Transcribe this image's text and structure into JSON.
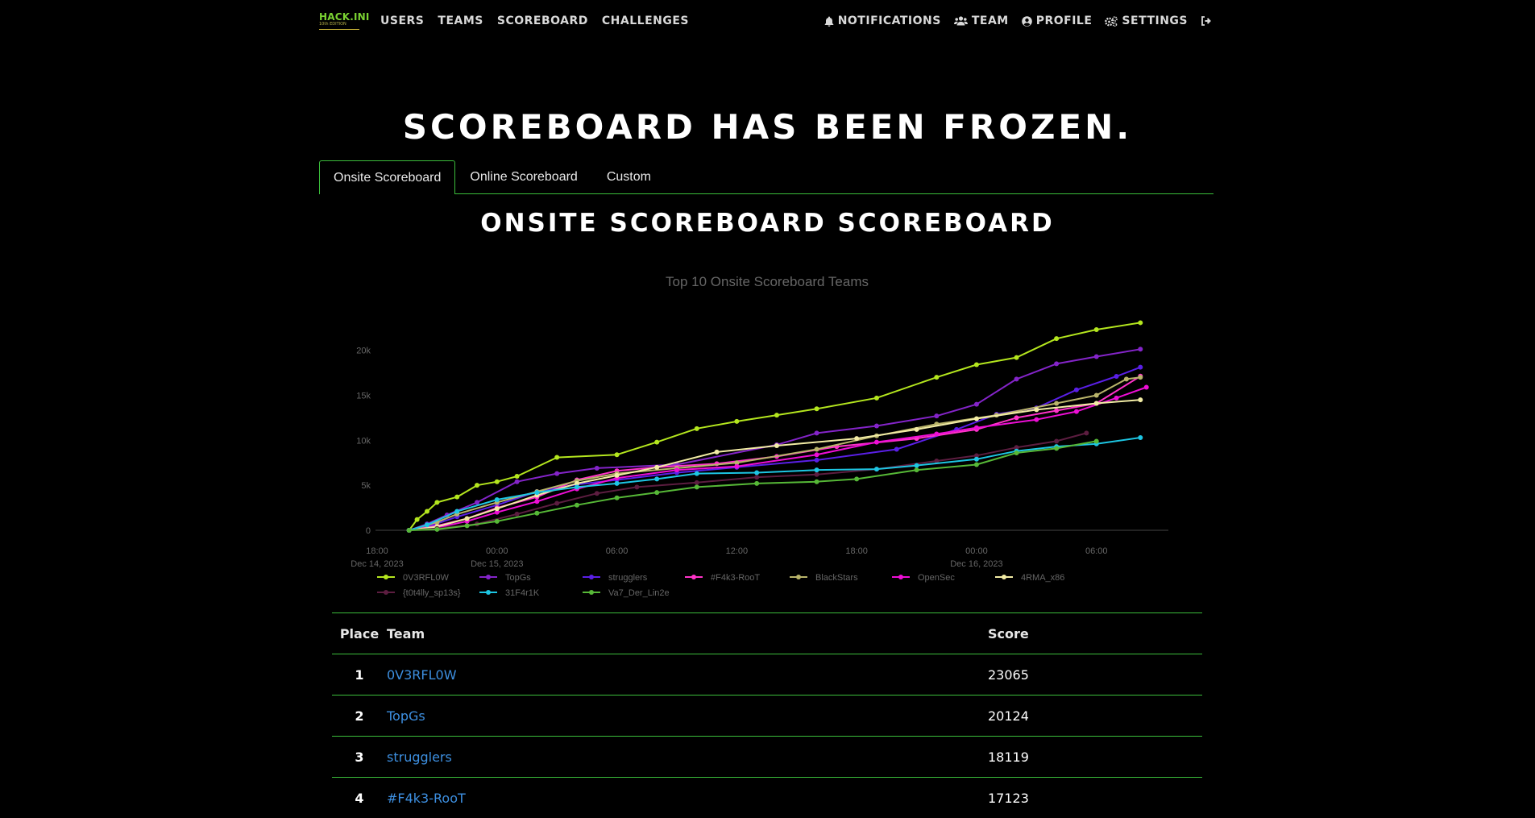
{
  "nav": {
    "logo": {
      "text": "HACK.INI",
      "sub": "10th EDITION"
    },
    "left": [
      "USERS",
      "TEAMS",
      "SCOREBOARD",
      "CHALLENGES"
    ],
    "right": {
      "notifications": "NOTIFICATIONS",
      "team": "TEAM",
      "profile": "PROFILE",
      "settings": "SETTINGS"
    },
    "icons": [
      "bell-icon",
      "users-icon",
      "user-circle-icon",
      "cogs-icon",
      "logout-icon"
    ]
  },
  "page": {
    "title": "SCOREBOARD HAS BEEN FROZEN.",
    "tabs": [
      "Onsite Scoreboard",
      "Online Scoreboard",
      "Custom"
    ],
    "active_tab": 0,
    "subtitle": "ONSITE SCOREBOARD SCOREBOARD"
  },
  "colors": {
    "accent": "#3bbd3b",
    "link": "#3d8fe0"
  },
  "chart_data": {
    "type": "line",
    "title": "Top 10 Onsite Scoreboard Teams",
    "x_ticks": [
      {
        "t": 18,
        "label": "18:00",
        "date": "Dec 14, 2023"
      },
      {
        "t": 24,
        "label": "00:00",
        "date": "Dec 15, 2023"
      },
      {
        "t": 30,
        "label": "06:00",
        "date": ""
      },
      {
        "t": 36,
        "label": "12:00",
        "date": ""
      },
      {
        "t": 42,
        "label": "18:00",
        "date": ""
      },
      {
        "t": 48,
        "label": "00:00",
        "date": "Dec 16, 2023"
      },
      {
        "t": 54,
        "label": "06:00",
        "date": ""
      }
    ],
    "xlim": [
      18,
      57.6
    ],
    "y_ticks": [
      {
        "v": 0,
        "label": "0"
      },
      {
        "v": 5000,
        "label": "5k"
      },
      {
        "v": 10000,
        "label": "10k"
      },
      {
        "v": 15000,
        "label": "15k"
      },
      {
        "v": 20000,
        "label": "20k"
      }
    ],
    "ylim": [
      0,
      24000
    ],
    "series": [
      {
        "name": "0V3RFL0W",
        "color": "#b4e61e",
        "points": [
          [
            19.6,
            0
          ],
          [
            20,
            1200
          ],
          [
            20.5,
            2100
          ],
          [
            21,
            3100
          ],
          [
            22,
            3700
          ],
          [
            23,
            5000
          ],
          [
            24,
            5400
          ],
          [
            25,
            6000
          ],
          [
            27,
            8100
          ],
          [
            30,
            8400
          ],
          [
            32,
            9800
          ],
          [
            34,
            11300
          ],
          [
            36,
            12100
          ],
          [
            38,
            12800
          ],
          [
            40,
            13500
          ],
          [
            43,
            14700
          ],
          [
            46,
            17000
          ],
          [
            48,
            18400
          ],
          [
            50,
            19200
          ],
          [
            52,
            21300
          ],
          [
            54,
            22300
          ],
          [
            56.2,
            23065
          ]
        ]
      },
      {
        "name": "TopGs",
        "color": "#8424c9",
        "points": [
          [
            19.6,
            0
          ],
          [
            20.5,
            700
          ],
          [
            21.5,
            1700
          ],
          [
            23,
            3100
          ],
          [
            25,
            5400
          ],
          [
            27,
            6300
          ],
          [
            29,
            6900
          ],
          [
            33,
            7300
          ],
          [
            38,
            9500
          ],
          [
            40,
            10800
          ],
          [
            43,
            11600
          ],
          [
            46,
            12700
          ],
          [
            48,
            14000
          ],
          [
            50,
            16800
          ],
          [
            52,
            18500
          ],
          [
            54,
            19300
          ],
          [
            56.2,
            20124
          ]
        ]
      },
      {
        "name": "strugglers",
        "color": "#5a1fe6",
        "points": [
          [
            19.6,
            0
          ],
          [
            20.8,
            600
          ],
          [
            22,
            1500
          ],
          [
            24,
            2800
          ],
          [
            26,
            4300
          ],
          [
            28,
            5100
          ],
          [
            30,
            5600
          ],
          [
            33,
            6400
          ],
          [
            36,
            7000
          ],
          [
            40,
            7800
          ],
          [
            44,
            9000
          ],
          [
            47,
            11200
          ],
          [
            49,
            12900
          ],
          [
            51,
            13600
          ],
          [
            53,
            15600
          ],
          [
            55,
            17100
          ],
          [
            56.2,
            18119
          ]
        ]
      },
      {
        "name": "#F4k3-RooT",
        "color": "#ff33c9",
        "points": [
          [
            19.6,
            0
          ],
          [
            21,
            500
          ],
          [
            22.5,
            1300
          ],
          [
            24,
            2500
          ],
          [
            26,
            3700
          ],
          [
            28,
            5600
          ],
          [
            30,
            6600
          ],
          [
            32,
            7000
          ],
          [
            35,
            7400
          ],
          [
            38,
            8200
          ],
          [
            41,
            9300
          ],
          [
            45,
            10200
          ],
          [
            48,
            11200
          ],
          [
            50,
            12500
          ],
          [
            52,
            13300
          ],
          [
            54,
            14100
          ],
          [
            56.2,
            17123
          ]
        ]
      },
      {
        "name": "BlackStars",
        "color": "#b9b46a",
        "points": [
          [
            19.6,
            0
          ],
          [
            21,
            900
          ],
          [
            22,
            1800
          ],
          [
            24,
            3100
          ],
          [
            26,
            4300
          ],
          [
            28,
            5500
          ],
          [
            30,
            6300
          ],
          [
            33,
            6900
          ],
          [
            36,
            7500
          ],
          [
            40,
            9000
          ],
          [
            43,
            10500
          ],
          [
            46,
            11800
          ],
          [
            49,
            12800
          ],
          [
            52,
            14100
          ],
          [
            54,
            15000
          ],
          [
            55.5,
            16800
          ],
          [
            56.2,
            17000
          ]
        ]
      },
      {
        "name": "OpenSec",
        "color": "#ee0ed6",
        "points": [
          [
            19.6,
            0
          ],
          [
            21,
            300
          ],
          [
            22.5,
            1000
          ],
          [
            24,
            2000
          ],
          [
            26,
            3200
          ],
          [
            28,
            4600
          ],
          [
            30,
            5800
          ],
          [
            33,
            6700
          ],
          [
            36,
            7100
          ],
          [
            40,
            8400
          ],
          [
            43,
            9800
          ],
          [
            46,
            10700
          ],
          [
            48,
            11400
          ],
          [
            51,
            12300
          ],
          [
            53,
            13200
          ],
          [
            55,
            14700
          ],
          [
            56.5,
            15900
          ]
        ]
      },
      {
        "name": "4RMA_x86",
        "color": "#f2eca5",
        "points": [
          [
            19.6,
            0
          ],
          [
            21,
            400
          ],
          [
            22.5,
            1300
          ],
          [
            24,
            2400
          ],
          [
            26,
            3900
          ],
          [
            28,
            5200
          ],
          [
            30,
            6100
          ],
          [
            32,
            7000
          ],
          [
            35,
            8700
          ],
          [
            38,
            9400
          ],
          [
            42,
            10200
          ],
          [
            45,
            11200
          ],
          [
            48,
            12400
          ],
          [
            51,
            13400
          ],
          [
            54,
            14100
          ],
          [
            56.2,
            14500
          ]
        ]
      },
      {
        "name": "{t0t4lly_sp13s}",
        "color": "#5c1d40",
        "points": [
          [
            19.6,
            0
          ],
          [
            21,
            200
          ],
          [
            23,
            700
          ],
          [
            25,
            1800
          ],
          [
            27,
            3000
          ],
          [
            29,
            4100
          ],
          [
            31,
            4800
          ],
          [
            34,
            5300
          ],
          [
            37,
            5900
          ],
          [
            40,
            6200
          ],
          [
            43,
            6800
          ],
          [
            46,
            7700
          ],
          [
            48,
            8300
          ],
          [
            50,
            9200
          ],
          [
            52,
            9900
          ],
          [
            53.5,
            10800
          ]
        ]
      },
      {
        "name": "31F4r1K",
        "color": "#1dc6e3",
        "points": [
          [
            19.6,
            0
          ],
          [
            20.5,
            600
          ],
          [
            22,
            2100
          ],
          [
            24,
            3400
          ],
          [
            26,
            4200
          ],
          [
            28,
            4800
          ],
          [
            30,
            5200
          ],
          [
            32,
            5700
          ],
          [
            34,
            6300
          ],
          [
            37,
            6400
          ],
          [
            40,
            6700
          ],
          [
            43,
            6800
          ],
          [
            45,
            7200
          ],
          [
            48,
            7900
          ],
          [
            50,
            8800
          ],
          [
            52,
            9300
          ],
          [
            54,
            9600
          ],
          [
            56.2,
            10300
          ]
        ]
      },
      {
        "name": "Va7_Der_Lin2e",
        "color": "#56b837",
        "points": [
          [
            19.6,
            0
          ],
          [
            21,
            100
          ],
          [
            22.5,
            500
          ],
          [
            24,
            1000
          ],
          [
            26,
            1900
          ],
          [
            28,
            2800
          ],
          [
            30,
            3600
          ],
          [
            32,
            4200
          ],
          [
            34,
            4800
          ],
          [
            37,
            5200
          ],
          [
            40,
            5400
          ],
          [
            42,
            5700
          ],
          [
            45,
            6700
          ],
          [
            48,
            7300
          ],
          [
            50,
            8600
          ],
          [
            52,
            9100
          ],
          [
            54,
            9900
          ]
        ]
      }
    ]
  },
  "table": {
    "headers": {
      "place": "Place",
      "team": "Team",
      "score": "Score"
    },
    "rows": [
      {
        "place": "1",
        "team": "0V3RFL0W",
        "score": "23065"
      },
      {
        "place": "2",
        "team": "TopGs",
        "score": "20124"
      },
      {
        "place": "3",
        "team": "strugglers",
        "score": "18119"
      },
      {
        "place": "4",
        "team": "#F4k3-RooT",
        "score": "17123"
      }
    ]
  }
}
